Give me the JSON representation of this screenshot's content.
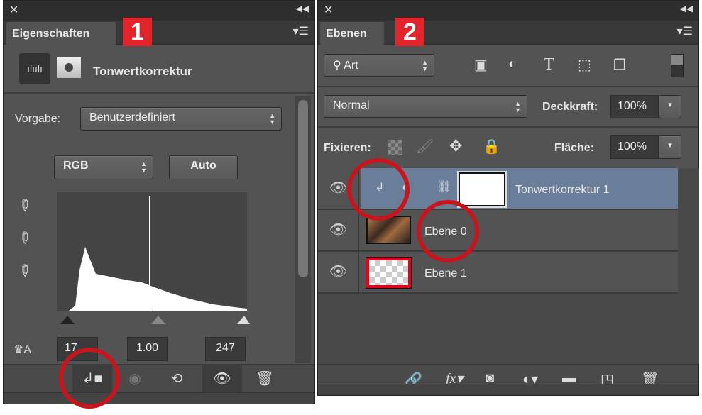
{
  "properties_panel": {
    "tab": "Eigenschaften",
    "badge": "1",
    "title": "Tonwertkorrektur",
    "vorgabe_label": "Vorgabe:",
    "vorgabe_value": "Benutzerdefiniert",
    "channel": "RGB",
    "auto_label": "Auto",
    "input_black": "17",
    "input_gamma": "1.00",
    "input_white": "247",
    "icons": [
      "levels-histogram-icon",
      "mask-icon",
      "eyedropper-black-icon",
      "eyedropper-gray-icon",
      "eyedropper-white-icon",
      "clip-to-layer-icon",
      "view-previous-icon",
      "reset-icon",
      "visibility-icon",
      "trash-icon"
    ]
  },
  "layers_panel": {
    "tab": "Ebenen",
    "badge": "2",
    "filter": "Art",
    "blend_mode": "Normal",
    "opacity_label": "Deckkraft:",
    "opacity": "100%",
    "lock_label": "Fixieren:",
    "fill_label": "Fläche:",
    "fill": "100%",
    "layers": [
      {
        "name": "Tonwertkorrektur 1",
        "selected": true
      },
      {
        "name": "Ebene 0",
        "selected": false
      },
      {
        "name": "Ebene 1",
        "selected": false
      }
    ],
    "icons": [
      "search-icon",
      "image-filter-icon",
      "adjustment-filter-icon",
      "type-filter-icon",
      "shape-filter-icon",
      "smart-object-filter-icon",
      "link-icon",
      "fx-icon",
      "mask-icon",
      "new-adjustment-icon",
      "folder-icon",
      "new-layer-icon",
      "trash-icon"
    ]
  },
  "colors": {
    "panel": "#535353",
    "selected_row": "#6a7d99",
    "annotation": "#c8141c",
    "badge": "#e3242b"
  }
}
